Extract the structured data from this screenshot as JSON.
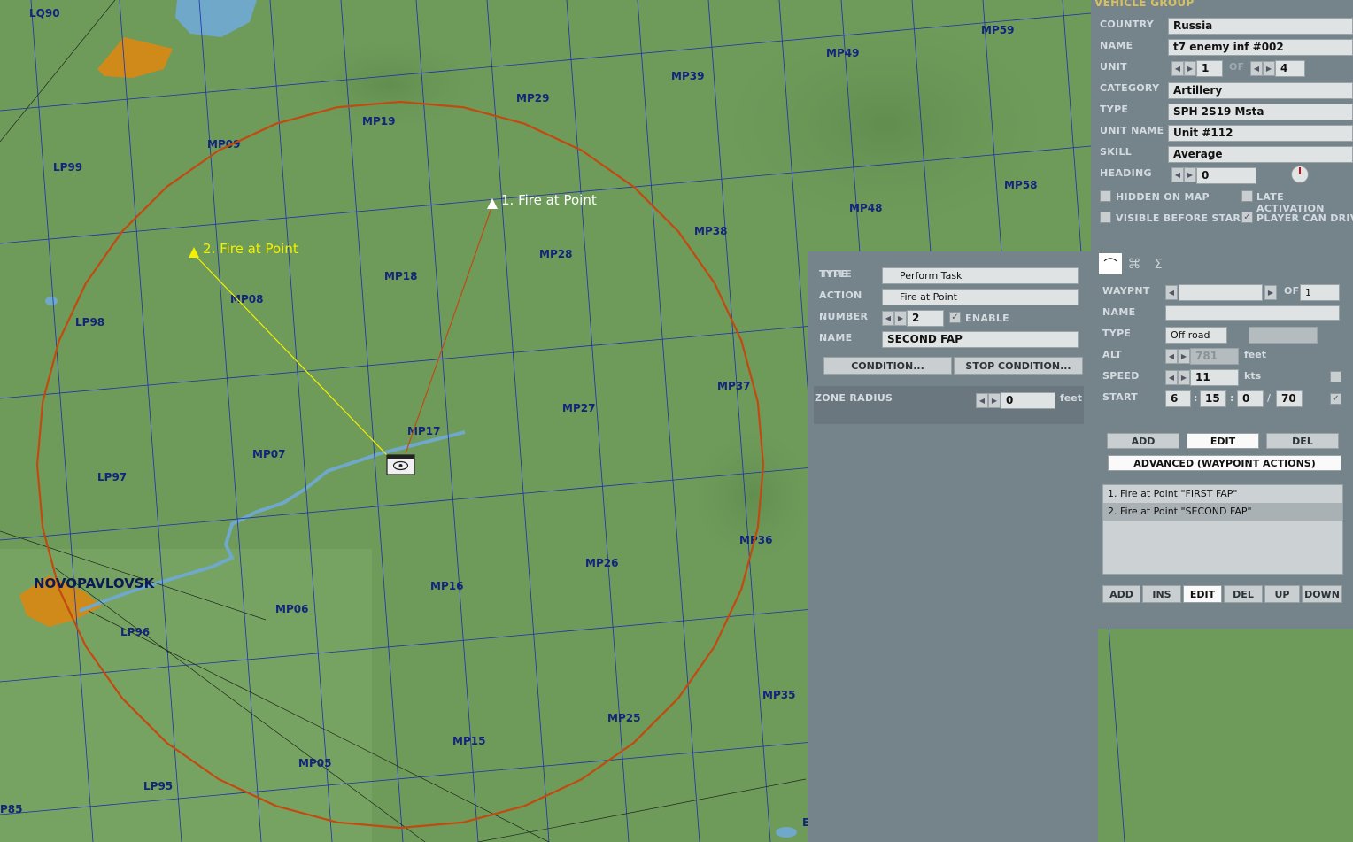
{
  "map": {
    "grid_labels": [
      "LQ90",
      "MP09",
      "MP19",
      "MP29",
      "MP39",
      "MP49",
      "MP59",
      "LP99",
      "MP08",
      "MP18",
      "MP28",
      "MP38",
      "MP48",
      "MP58",
      "LP98",
      "MP07",
      "MP17",
      "MP27",
      "MP37",
      "LP97",
      "MP06",
      "MP16",
      "MP26",
      "MP36",
      "LP96",
      "MP05",
      "MP15",
      "MP25",
      "MP35",
      "LP95",
      "P85",
      "E"
    ],
    "city": "NOVOPAVLOVSK",
    "waypoint_1": "1. Fire at Point",
    "waypoint_2": "2. Fire at Point",
    "colors": {
      "terrain": "#6e9a5a",
      "grid_line": "#1f2fb0",
      "zone_circle": "#c24a10",
      "water": "#6fa8c8",
      "city_area": "#d08a1a"
    }
  },
  "vehicle_group": {
    "title": "VEHICLE GROUP",
    "country_label": "COUNTRY",
    "country": "Russia",
    "name_label": "NAME",
    "name": "t7 enemy inf #002",
    "unit_label": "UNIT",
    "unit_value": "1",
    "of_label": "OF",
    "unit_total": "4",
    "category_label": "CATEGORY",
    "category": "Artillery",
    "type_label": "TYPE",
    "type": "SPH 2S19 Msta",
    "unit_name_label": "UNIT NAME",
    "unit_name": "Unit #112",
    "skill_label": "SKILL",
    "skill": "Average",
    "heading_label": "HEADING",
    "heading": "0",
    "hidden_on_map": "HIDDEN ON MAP",
    "late_activation": "LATE ACTIVATION",
    "visible_before_start": "VISIBLE BEFORE STAR",
    "player_can_drive": "PLAYER CAN DRIV",
    "player_can_drive_checked": true
  },
  "route": {
    "tabs": [
      "route-icon",
      "triggered-actions-icon",
      "summary-icon"
    ],
    "waypnt_label": "WAYPNT",
    "waypnt_value": "",
    "of_label": "OF",
    "waypnt_total": "1",
    "name_label": "NAME",
    "name_value": "",
    "type_label": "TYPE",
    "type_value": "Off road",
    "type_extra": "",
    "alt_label": "ALT",
    "alt_value": "781",
    "alt_unit": "feet",
    "speed_label": "SPEED",
    "speed_value": "11",
    "speed_unit": "kts",
    "start_label": "START",
    "start_h": "6",
    "start_m": "15",
    "start_s": "0",
    "start_d": "70",
    "sep_colon_1": ":",
    "sep_colon_2": ":",
    "sep_slash": "/",
    "add": "ADD",
    "edit": "EDIT",
    "del": "DEL",
    "advanced": "ADVANCED (WAYPOINT ACTIONS)",
    "actions": [
      "1. Fire at Point \"FIRST FAP\"",
      "2. Fire at Point \"SECOND FAP\""
    ],
    "selected_index": 1,
    "list_buttons": [
      "ADD",
      "INS",
      "EDIT",
      "DEL",
      "UP",
      "DOWN"
    ]
  },
  "action": {
    "type_label": "TYPE",
    "title_label": "TITLE",
    "type_value": "Perform Task",
    "action_label": "ACTION",
    "action_value": "Fire at Point",
    "number_label": "NUMBER",
    "number_value": "2",
    "enable_label": "ENABLE",
    "name_label": "NAME",
    "name_value": "SECOND FAP",
    "condition": "CONDITION...",
    "stop_condition": "STOP CONDITION...",
    "zone_radius_label": "ZONE RADIUS",
    "zone_radius_value": "0",
    "zone_radius_unit": "feet"
  }
}
